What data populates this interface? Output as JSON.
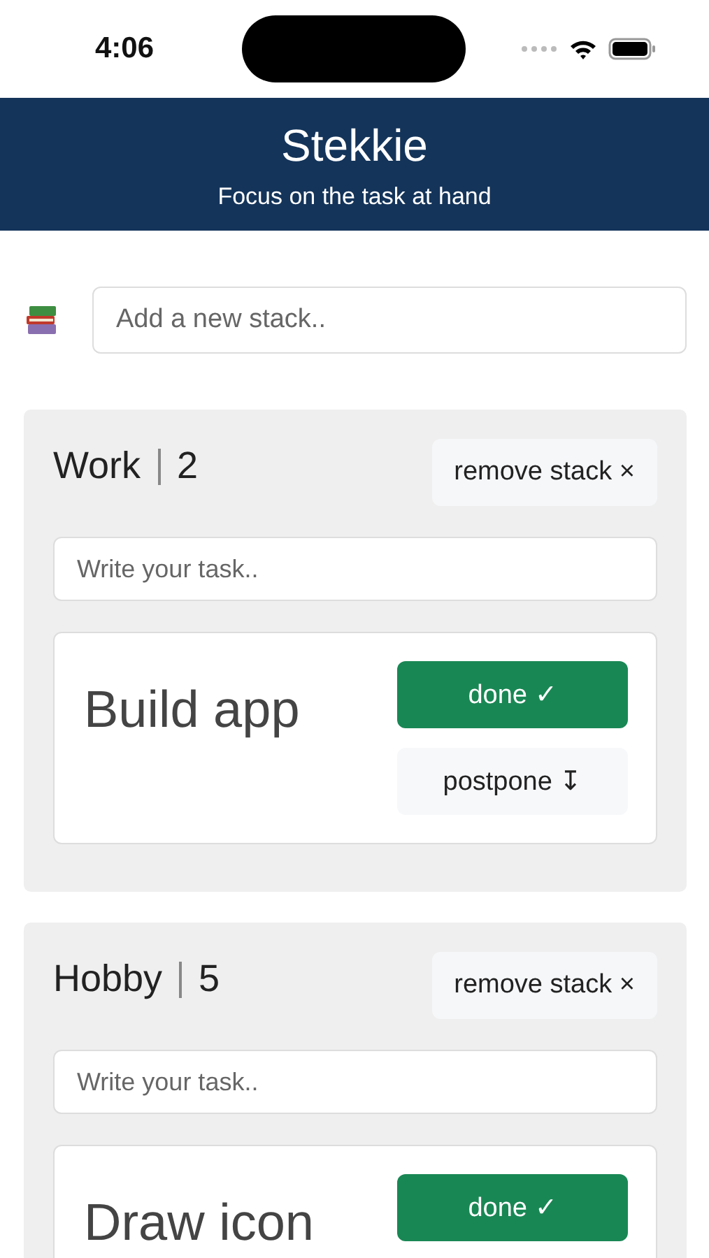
{
  "status_bar": {
    "time": "4:06"
  },
  "header": {
    "title": "Stekkie",
    "subtitle": "Focus on the task at hand"
  },
  "new_stack": {
    "placeholder": "Add a new stack.."
  },
  "stacks": [
    {
      "name": "Work",
      "count": "2",
      "remove_label": "remove stack ×",
      "task_placeholder": "Write your task..",
      "tasks": [
        {
          "title": "Build app",
          "actions": [
            {
              "kind": "done",
              "label": "done ✓"
            },
            {
              "kind": "postpone",
              "label": "postpone ↧"
            }
          ]
        }
      ]
    },
    {
      "name": "Hobby",
      "count": "5",
      "remove_label": "remove stack ×",
      "task_placeholder": "Write your task..",
      "tasks": [
        {
          "title": "Draw icon",
          "actions": [
            {
              "kind": "done",
              "label": "done ✓"
            }
          ]
        }
      ]
    }
  ]
}
